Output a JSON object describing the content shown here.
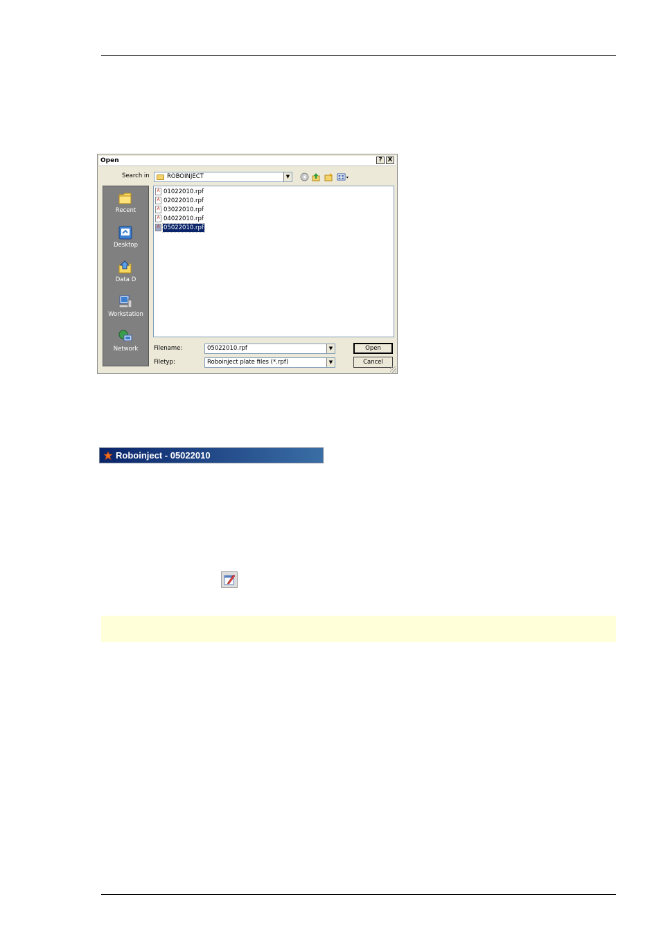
{
  "dialog": {
    "title": "Open",
    "help_button": "?",
    "close_button": "X",
    "search_in_label": "Search in",
    "search_in_value": "ROBOINJECT",
    "places": [
      {
        "label": "Recent",
        "icon": "recent-folder-icon"
      },
      {
        "label": "Desktop",
        "icon": "desktop-icon"
      },
      {
        "label": "Data D",
        "icon": "data-drive-icon"
      },
      {
        "label": "Workstation",
        "icon": "workstation-icon"
      },
      {
        "label": "Network",
        "icon": "network-icon"
      }
    ],
    "files": [
      {
        "name": "01022010.rpf",
        "selected": false
      },
      {
        "name": "02022010.rpf",
        "selected": false
      },
      {
        "name": "03022010.rpf",
        "selected": false
      },
      {
        "name": "04022010.rpf",
        "selected": false
      },
      {
        "name": "05022010.rpf",
        "selected": true
      }
    ],
    "filename_label": "Filename:",
    "filename_value": "05022010.rpf",
    "filetype_label": "Filetyp:",
    "filetype_value": "Roboinject plate files (*.rpf)",
    "open_button": "Open",
    "cancel_button": "Cancel"
  },
  "app_window": {
    "title": "Roboinject - 05022010"
  },
  "colors": {
    "dialog_bg": "#ece9d8",
    "selection": "#0a246a",
    "titlebar_start": "#0a246a",
    "titlebar_end": "#3a6ea5",
    "note_band": "#ffffd9"
  }
}
